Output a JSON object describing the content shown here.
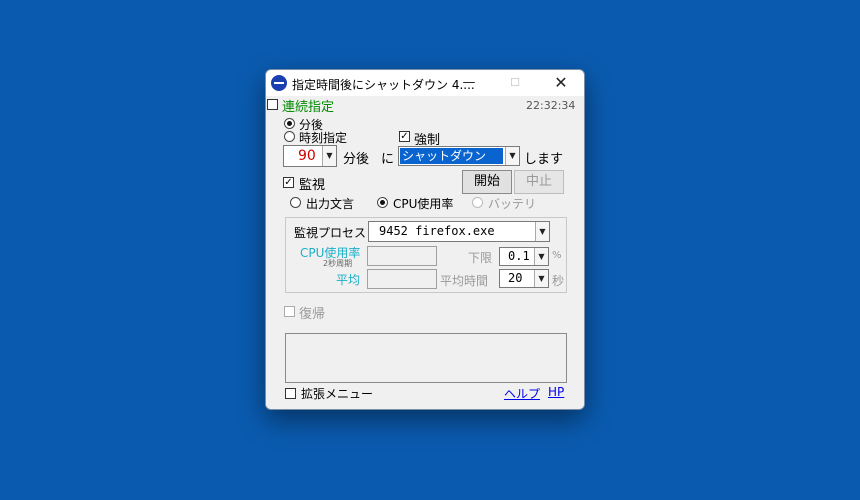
{
  "window": {
    "title": "指定時間後にシャットダウン 4....",
    "controls": {
      "minimize": "—",
      "maximize": "☐",
      "close": "✕"
    }
  },
  "header": {
    "continuous_label": "連続指定",
    "clock": "22:32:34"
  },
  "timer": {
    "mode_after_label": "分後",
    "mode_time_label": "時刻指定",
    "force_label": "強制",
    "minutes_value": "90",
    "minutes_unit": "分後",
    "ni_label": "に",
    "action_value": "シャットダウン",
    "shimasu_label": "します"
  },
  "monitor": {
    "label": "監視",
    "start_button": "開始",
    "stop_button": "中止",
    "options": [
      "出力文言",
      "CPU使用率",
      "バッテリ"
    ],
    "process_label": "監視プロセス",
    "process_value": "9452 firefox.exe",
    "cpu_label": "CPU使用率",
    "cpu_sublabel": "2秒周期",
    "lower_label": "下限",
    "lower_value": "0.1",
    "lower_unit": "%",
    "avg_label": "平均",
    "avg_time_label": "平均時間",
    "avg_time_value": "20",
    "avg_time_unit": "秒"
  },
  "restore": {
    "label": "復帰"
  },
  "footer": {
    "extended_menu_label": "拡張メニュー",
    "help_link": "ヘルプ",
    "hp_link": "HP"
  },
  "colors": {
    "desktop": "#0a5bb0",
    "accent_green": "#008a00",
    "accent_teal": "#1ab0c8",
    "selection": "#0a64d0"
  }
}
